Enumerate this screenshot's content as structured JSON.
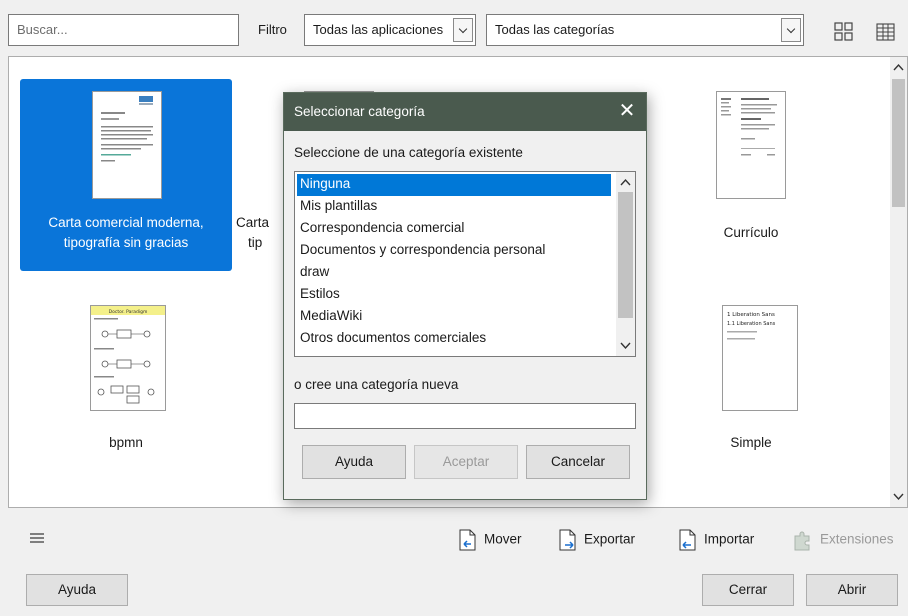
{
  "toolbar": {
    "search_placeholder": "Buscar...",
    "filter_label": "Filtro",
    "app_filter": "Todas las aplicaciones",
    "category_filter": "Todas las categorías"
  },
  "templates": [
    {
      "name": "Carta comercial moderna, tipografía sin gracias",
      "line1": "Carta comercial moderna,",
      "line2": "tipografía sin gracias",
      "selected": true
    },
    {
      "line1": "Carta",
      "line2": "tip"
    },
    {
      "name": "Currículo",
      "line1": "Currículo"
    },
    {
      "name": "bpmn",
      "line1": "bpmn"
    },
    {
      "name": "Simple",
      "line1": "Simple"
    }
  ],
  "thumb_text": {
    "simple_heading1": "1 Liberation Sans",
    "simple_heading2": "1.1 Liberation Sans",
    "bpmn_title": "Doctor. Paradigm"
  },
  "actions": {
    "move": "Mover",
    "export": "Exportar",
    "import": "Importar",
    "extensions": "Extensiones"
  },
  "buttons": {
    "help": "Ayuda",
    "close": "Cerrar",
    "open": "Abrir"
  },
  "dialog": {
    "title": "Seleccionar categoría",
    "existing_label": "Seleccione de una categoría existente",
    "categories": [
      "Ninguna",
      "Mis plantillas",
      "Correspondencia comercial",
      "Documentos y correspondencia personal",
      "draw",
      "Estilos",
      "MediaWiki",
      "Otros documentos comerciales"
    ],
    "selected_index": 0,
    "new_label": "o cree una categoría nueva",
    "new_value": "",
    "help_btn": "Ayuda",
    "accept_btn": "Aceptar",
    "cancel_btn": "Cancelar"
  },
  "colors": {
    "selection": "#0a75d9",
    "dialog_title_bg": "#4a5a4e"
  }
}
